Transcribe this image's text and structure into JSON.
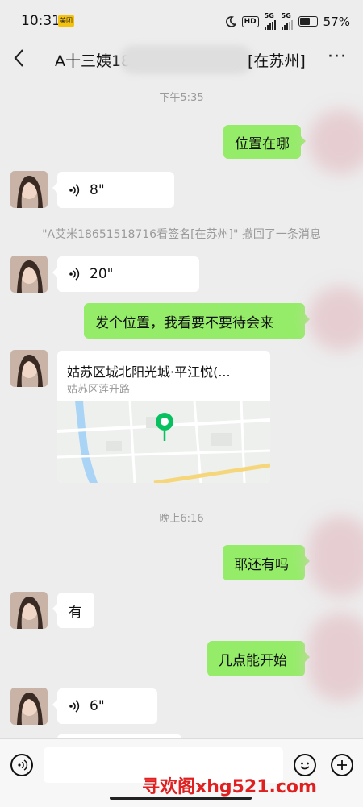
{
  "status_bar": {
    "time": "10:31",
    "meituan_badge": "美团",
    "hd": "HD",
    "network1": "5G",
    "network2": "5G",
    "battery_percent": "57%",
    "battery_level": 0.57
  },
  "header": {
    "title_prefix": "A十三姨18",
    "title_suffix": "[在苏州]",
    "more": "···"
  },
  "messages": {
    "time1": "下午5:35",
    "out1": "位置在哪",
    "in1_voice": "8\"",
    "recall_notice": "\"A艾米18651518716看签名[在苏州]\" 撤回了一条消息",
    "in2_voice": "20\"",
    "out2": "发个位置，我看要不要待会来",
    "location": {
      "title": "姑苏区城北阳光城·平江悦(...",
      "subtitle": "姑苏区莲升路"
    },
    "time2": "晚上6:16",
    "out3": "耶还有吗",
    "in3": "有",
    "out4": "几点能开始",
    "in4_voice": "6\""
  },
  "watermark": "寻欢阁xhg521.com",
  "icons": [
    "moon-icon",
    "signal-icon",
    "battery-icon",
    "back-icon",
    "more-icon",
    "voice-icon",
    "map-pin-icon",
    "emoji-icon",
    "plus-icon",
    "voice-input-icon"
  ],
  "colors": {
    "outgoing_bubble": "#95ec69",
    "incoming_bubble": "#ffffff",
    "background": "#ededed",
    "pin": "#07c160",
    "watermark": "#e02020"
  }
}
